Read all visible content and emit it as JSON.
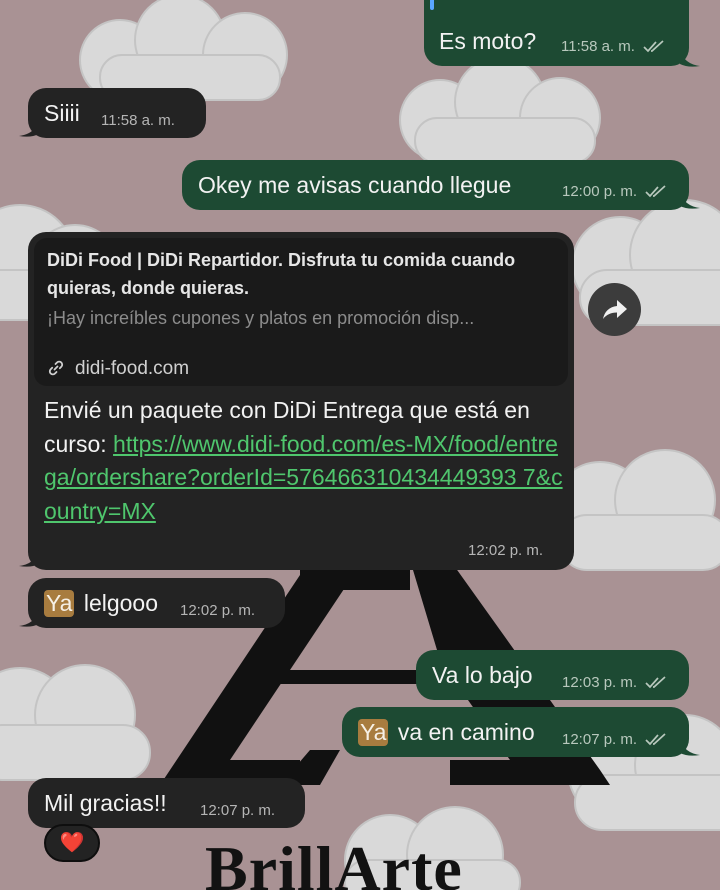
{
  "messages": [
    {
      "id": "m1",
      "direction": "out",
      "text": "Es moto?",
      "time": "11:58 a. m.",
      "status": "read"
    },
    {
      "id": "m2",
      "direction": "in",
      "text": "Siiii",
      "time": "11:58 a. m."
    },
    {
      "id": "m3",
      "direction": "out",
      "text": "Okey me avisas cuando llegue",
      "time": "12:00 p. m.",
      "status": "read"
    },
    {
      "id": "m4",
      "direction": "in",
      "type": "link",
      "preview": {
        "title": "DiDi Food | DiDi Repartidor. Disfruta tu comida cuando quieras, donde quieras.",
        "description": "¡Hay increíbles cupones y platos en promoción disp...",
        "domain": "didi-food.com"
      },
      "text_before": "Envié un paquete con DiDi Entrega que está en curso: ",
      "url": "https://www.didi-food.com/es-MX/food/entrega/ordershare?orderId=576466310434449393 7&country=MX",
      "time": "12:02 p. m."
    },
    {
      "id": "m5",
      "direction": "in",
      "tag": "Ya",
      "text": " lelgooo",
      "time": "12:02 p. m."
    },
    {
      "id": "m6",
      "direction": "out",
      "text": "Va lo bajo",
      "time": "12:03 p. m.",
      "status": "read"
    },
    {
      "id": "m7",
      "direction": "out",
      "tag": "Ya",
      "text": " va en camino",
      "time": "12:07 p. m.",
      "status": "read"
    },
    {
      "id": "m8",
      "direction": "in",
      "text": "Mil gracias!!",
      "time": "12:07 p. m.",
      "reaction": "❤️"
    }
  ],
  "wallpaper": {
    "brand_text": "BrillArte"
  },
  "colors": {
    "background": "#a99294",
    "bubble_in": "#232323",
    "bubble_out": "#1d4a33",
    "link": "#4fc66d",
    "highlight_tag": "#a87c3f"
  },
  "icons": {
    "forward": "share-forward-icon",
    "link": "link-chain-icon",
    "read_receipt": "double-check-icon",
    "reaction": "red-heart-icon"
  }
}
